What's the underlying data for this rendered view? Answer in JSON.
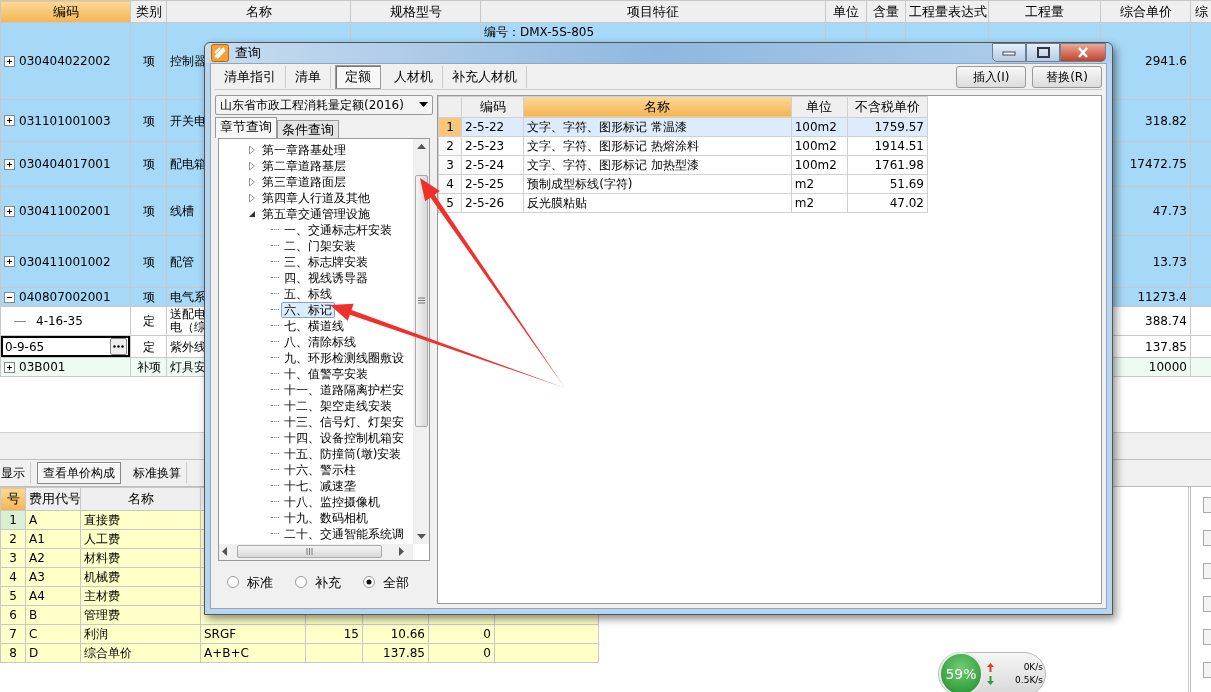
{
  "grid": {
    "columns": [
      "编码",
      "类别",
      "名称",
      "规格型号",
      "项目特征",
      "单位",
      "含量",
      "工程量表达式",
      "工程量",
      "综合单价",
      "综"
    ],
    "rows": [
      {
        "kind": "item",
        "expanded": false,
        "selected": true,
        "code": "030404022002",
        "type": "项",
        "name": "控制器",
        "feature": "编号：DMX-5S-805",
        "price": "2941.6"
      },
      {
        "kind": "item",
        "expanded": false,
        "selected": true,
        "code": "031101001003",
        "type": "项",
        "name": "开关电",
        "price": "318.82"
      },
      {
        "kind": "item",
        "expanded": false,
        "selected": true,
        "code": "030404017001",
        "type": "项",
        "name": "配电箱",
        "price": "17472.75"
      },
      {
        "kind": "item",
        "expanded": false,
        "selected": true,
        "code": "030411002001",
        "type": "项",
        "name": "线槽",
        "price": "47.73"
      },
      {
        "kind": "item",
        "expanded": false,
        "selected": true,
        "code": "030411001002",
        "type": "项",
        "name": "配管",
        "price": "13.73"
      },
      {
        "kind": "item",
        "expanded": true,
        "selected": true,
        "code": "040807002001",
        "type": "项",
        "name": "电气系",
        "price": "11273.4"
      },
      {
        "kind": "quota",
        "selected": false,
        "code": "4-16-35",
        "type": "定",
        "name": "送配电电（综",
        "price": "388.74"
      },
      {
        "kind": "edit",
        "selected": false,
        "code": "0-9-65",
        "type": "定",
        "name": "紫外线",
        "price": "137.85"
      },
      {
        "kind": "supplement",
        "expanded": false,
        "selected": false,
        "code": "03B001",
        "type": "补项",
        "name": "灯具安",
        "price": "10000"
      }
    ]
  },
  "lower_tabs": [
    {
      "label": "显示",
      "selected": false
    },
    {
      "label": "查看单价构成",
      "selected": true
    },
    {
      "label": "标准换算",
      "selected": false
    }
  ],
  "cost_table": {
    "columns": [
      "号",
      "费用代号",
      "名称"
    ],
    "rows": [
      {
        "no": "1",
        "code": "A",
        "name": "直接费",
        "selected": true
      },
      {
        "no": "2",
        "code": "A1",
        "name": "人工费",
        "selected": false
      },
      {
        "no": "3",
        "code": "A2",
        "name": "材料费",
        "selected": false
      },
      {
        "no": "4",
        "code": "A3",
        "name": "机械费",
        "selected": false
      },
      {
        "no": "5",
        "code": "A4",
        "name": "主材费",
        "selected": false
      },
      {
        "no": "6",
        "code": "B",
        "name": "管理费",
        "selected": false
      },
      {
        "no": "7",
        "code": "C",
        "name": "利润",
        "selected": false,
        "base": "SRGF",
        "rate": "15",
        "amount": "10.66",
        "column_7": "0"
      },
      {
        "no": "8",
        "code": "D",
        "name": "综合单价",
        "selected": false,
        "base": "A+B+C",
        "amount": "137.85",
        "column_7": "0"
      }
    ]
  },
  "dialog": {
    "title": "查询",
    "tabs": [
      {
        "label": "清单指引",
        "selected": false
      },
      {
        "label": "清单",
        "selected": false
      },
      {
        "label": "定额",
        "selected": true
      },
      {
        "label": "人材机",
        "selected": false
      },
      {
        "label": "补充人材机",
        "selected": false
      }
    ],
    "buttons": [
      "插入(I)",
      "替换(R)"
    ],
    "quota_set": "山东省市政工程消耗量定额(2016)",
    "query_tabs": [
      {
        "label": "章节查询",
        "selected": true
      },
      {
        "label": "条件查询",
        "selected": false
      }
    ],
    "tree": [
      {
        "label": "第一章路基处理",
        "expanded": false,
        "selected": false
      },
      {
        "label": "第二章道路基层",
        "expanded": false,
        "selected": false
      },
      {
        "label": "第三章道路面层",
        "expanded": false,
        "selected": false
      },
      {
        "label": "第四章人行道及其他",
        "expanded": false,
        "selected": false
      },
      {
        "label": "第五章交通管理设施",
        "expanded": true,
        "selected": false,
        "children": [
          {
            "label": "一、交通标志杆安装",
            "selected": false
          },
          {
            "label": "二、门架安装",
            "selected": false
          },
          {
            "label": "三、标志牌安装",
            "selected": false
          },
          {
            "label": "四、视线诱导器",
            "selected": false
          },
          {
            "label": "五、标线",
            "selected": false
          },
          {
            "label": "六、标记",
            "selected": true
          },
          {
            "label": "七、横道线",
            "selected": false
          },
          {
            "label": "八、清除标线",
            "selected": false
          },
          {
            "label": "九、环形检测线圈敷设",
            "selected": false
          },
          {
            "label": "十、值警亭安装",
            "selected": false
          },
          {
            "label": "十一、道路隔离护栏安",
            "selected": false
          },
          {
            "label": "十二、架空走线安装",
            "selected": false
          },
          {
            "label": "十三、信号灯、灯架安",
            "selected": false
          },
          {
            "label": "十四、设备控制机箱安",
            "selected": false
          },
          {
            "label": "十五、防撞筒(墩)安装",
            "selected": false
          },
          {
            "label": "十六、警示柱",
            "selected": false
          },
          {
            "label": "十七、减速垄",
            "selected": false
          },
          {
            "label": "十八、监控摄像机",
            "selected": false
          },
          {
            "label": "十九、数码相机",
            "selected": false
          },
          {
            "label": "二十、交通智能系统调",
            "selected": false
          }
        ]
      }
    ],
    "filters": [
      {
        "label": "标准",
        "selected": false
      },
      {
        "label": "补充",
        "selected": false
      },
      {
        "label": "全部",
        "selected": true
      }
    ],
    "results": {
      "columns": [
        "编码",
        "名称",
        "单位",
        "不含税单价"
      ],
      "rows": [
        {
          "no": "1",
          "code": "2-5-22",
          "name": "文字、字符、图形标记 常温漆",
          "unit": "100m2",
          "price": "1759.57",
          "selected": true
        },
        {
          "no": "2",
          "code": "2-5-23",
          "name": "文字、字符、图形标记 热熔涂料",
          "unit": "100m2",
          "price": "1914.51",
          "selected": false
        },
        {
          "no": "3",
          "code": "2-5-24",
          "name": "文字、字符、图形标记 加热型漆",
          "unit": "100m2",
          "price": "1761.98",
          "selected": false
        },
        {
          "no": "4",
          "code": "2-5-25",
          "name": "预制成型标线(字符)",
          "unit": "m2",
          "price": "51.69",
          "selected": false
        },
        {
          "no": "5",
          "code": "2-5-26",
          "name": "反光膜粘贴",
          "unit": "m2",
          "price": "47.02",
          "selected": false
        }
      ]
    }
  },
  "network": {
    "percent": "59%",
    "upload": "0K/s",
    "download": "0.5K/s"
  }
}
